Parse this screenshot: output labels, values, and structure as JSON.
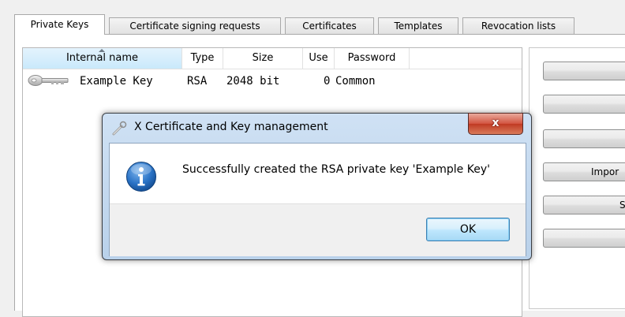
{
  "tabs": [
    {
      "label": "Private Keys",
      "active": true
    },
    {
      "label": "Certificate signing requests",
      "active": false
    },
    {
      "label": "Certificates",
      "active": false
    },
    {
      "label": "Templates",
      "active": false
    },
    {
      "label": "Revocation lists",
      "active": false
    }
  ],
  "list": {
    "columns": [
      "Internal name",
      "Type",
      "Size",
      "Use",
      "Password"
    ],
    "sorted_column": "Internal name",
    "rows": [
      {
        "name": "Example Key",
        "type": "RSA",
        "size": "2048 bit",
        "use": "0",
        "password": "Common",
        "icon": "key-icon"
      }
    ]
  },
  "side_buttons": [
    "",
    "",
    "",
    "Impor",
    "S",
    ""
  ],
  "dialog": {
    "title": "X Certificate and Key management",
    "title_icon": "certificate-tool-icon",
    "close_label": "x",
    "message": "Successfully created the RSA private key 'Example Key'",
    "message_icon": "info-icon",
    "ok_label": "OK"
  },
  "colors": {
    "dialog_frame": "#b9d1ea",
    "close_button": "#c03a23",
    "info_blue": "#1f67b9",
    "ok_border": "#3c7fb1"
  }
}
